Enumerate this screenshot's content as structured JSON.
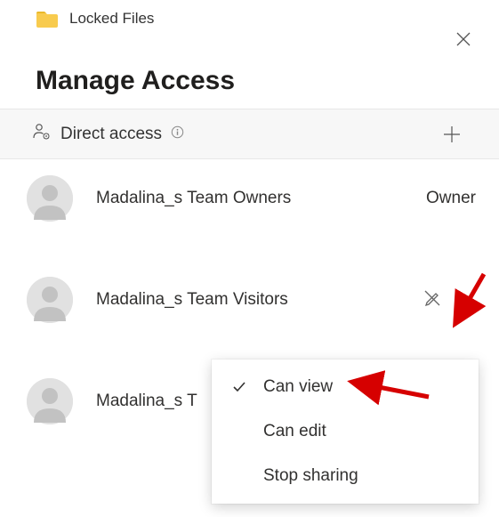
{
  "header": {
    "title": "Locked Files"
  },
  "page": {
    "title": "Manage Access"
  },
  "section": {
    "title": "Direct access"
  },
  "members": {
    "m1": {
      "name": "Madalina_s Team Owners",
      "role": "Owner"
    },
    "m2": {
      "name": "Madalina_s Team Visitors"
    },
    "m3": {
      "name": "Madalina_s T"
    }
  },
  "dropdown": {
    "canView": "Can view",
    "canEdit": "Can edit",
    "stopSharing": "Stop sharing"
  },
  "colors": {
    "arrow": "#d60000",
    "folder": "#f8cb4e"
  }
}
